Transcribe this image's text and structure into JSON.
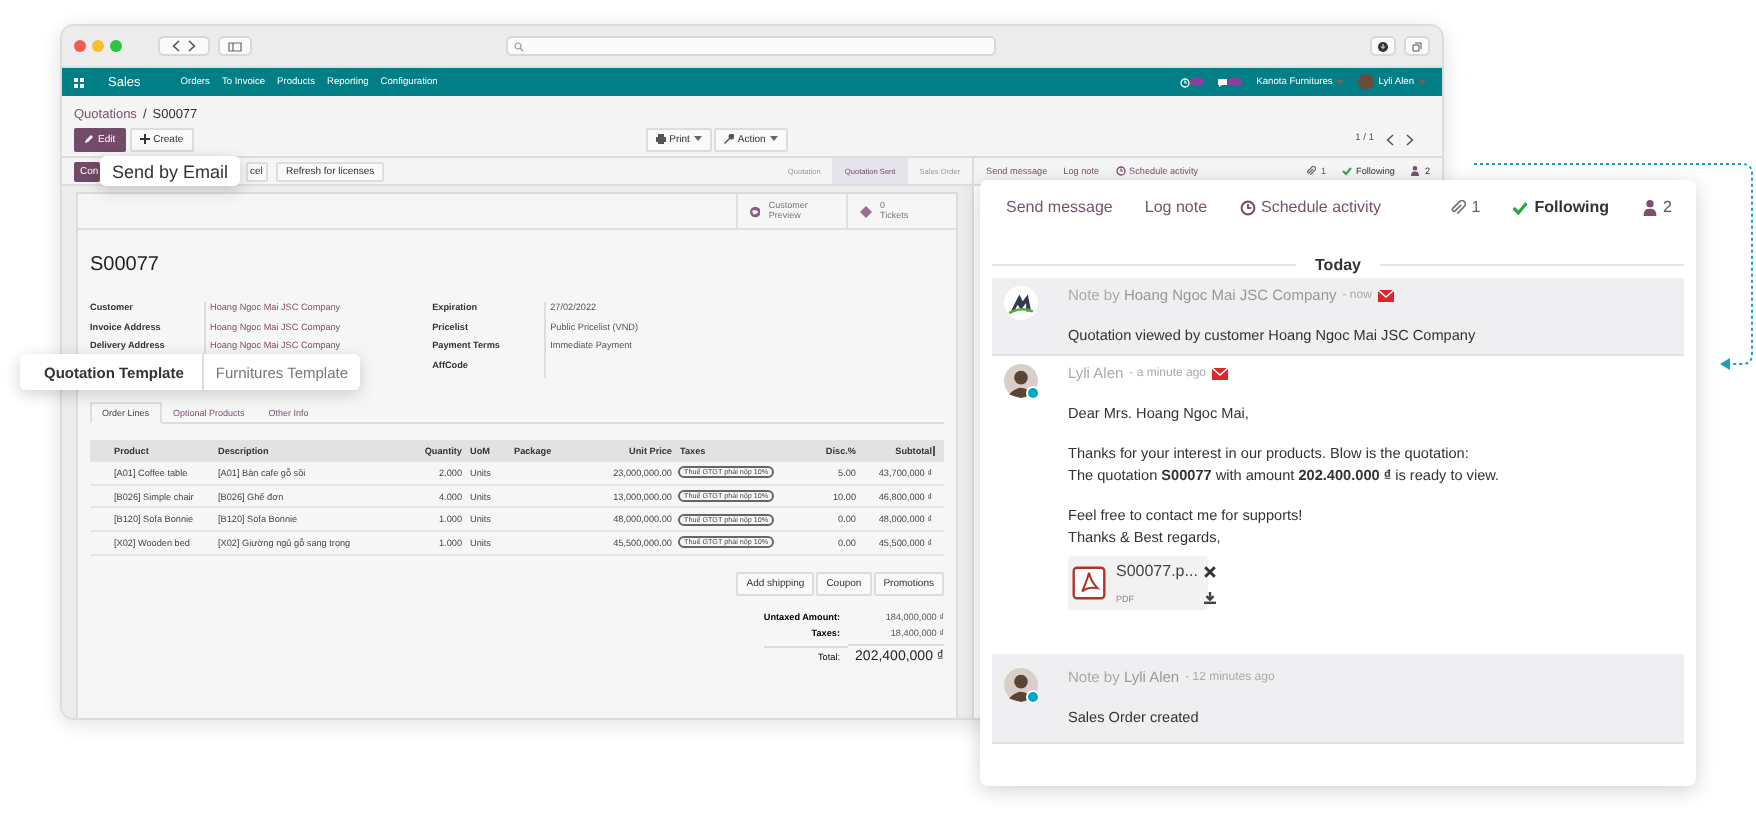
{
  "navbar": {
    "app": "Sales",
    "menu": [
      "Orders",
      "To Invoice",
      "Products",
      "Reporting",
      "Configuration"
    ],
    "company": "Kanota Furnitures",
    "user": "Lyli Alen"
  },
  "breadcrumb": {
    "parent": "Quotations",
    "separator": "/",
    "current": "S00077"
  },
  "actions": [
    {
      "label": "Edit",
      "kind": "primary"
    },
    {
      "label": "Create",
      "kind": "secondary"
    }
  ],
  "dropdowns": [
    "Print",
    "Action"
  ],
  "pager": "1 / 1",
  "header_buttons": [
    {
      "label": "Con",
      "kind": "primary"
    },
    {
      "label": "cel",
      "kind": "secondary"
    },
    {
      "label": "Refresh for licenses",
      "kind": "secondary"
    }
  ],
  "status_steps": [
    {
      "label": "Quotation",
      "selected": false
    },
    {
      "label": "Quotation Sent",
      "selected": true
    },
    {
      "label": "Sales Order",
      "selected": false
    }
  ],
  "smart_buttons": [
    {
      "kind": "preview",
      "label": "Customer Preview"
    },
    {
      "kind": "tickets",
      "count": "0",
      "label": "Tickets"
    }
  ],
  "title": "S00077",
  "fields_left": [
    {
      "label": "Customer",
      "value": "Hoang Ngoc Mai JSC Company"
    },
    {
      "label": "Invoice Address",
      "value": "Hoang Ngoc Mai JSC Company"
    },
    {
      "label": "Delivery Address",
      "value": "Hoang Ngoc Mai JSC Company"
    }
  ],
  "fields_right": [
    {
      "label": "Expiration",
      "value": "27/02/2022"
    },
    {
      "label": "Pricelist",
      "value": "Public Pricelist (VND)"
    },
    {
      "label": "Payment Terms",
      "value": "Immediate Payment"
    },
    {
      "label": "AffCode"
    }
  ],
  "notebook_tabs": [
    {
      "label": "Order Lines",
      "selected": true
    },
    {
      "label": "Optional Products",
      "selected": false
    },
    {
      "label": "Other Info",
      "selected": false
    }
  ],
  "order_lines": {
    "columns": [
      "Product",
      "Description",
      "Quantity",
      "UoM",
      "Package",
      "Unit Price",
      "Taxes",
      "Disc.%",
      "Subtotal"
    ],
    "rows": [
      {
        "product": "[A01] Coffee table",
        "description": "[A01] Bàn cafe gỗ sồi",
        "quantity": "2.000",
        "uom": "Units",
        "unit_price": "23,000,000.00",
        "tax": "Thuế GTGT phải nộp 10%",
        "discount": "5.00",
        "subtotal": "43,700,000 ₫"
      },
      {
        "product": "[B026] Simple chair",
        "description": "[B026] Ghế đơn",
        "quantity": "4.000",
        "uom": "Units",
        "unit_price": "13,000,000.00",
        "tax": "Thuế GTGT phải nộp 10%",
        "discount": "10.00",
        "subtotal": "46,800,000 ₫"
      },
      {
        "product": "[B120] Sofa Bonnie",
        "description": "[B120] Sofa Bonnie",
        "quantity": "1.000",
        "uom": "Units",
        "unit_price": "48,000,000.00",
        "tax": "Thuế GTGT phải nộp 10%",
        "discount": "0.00",
        "subtotal": "48,000,000 ₫"
      },
      {
        "product": "[X02] Wooden bed",
        "description": "[X02] Giường ngủ gỗ sang trọng",
        "quantity": "1.000",
        "uom": "Units",
        "unit_price": "45,500,000.00",
        "tax": "Thuế GTGT phải nộp 10%",
        "discount": "0.00",
        "subtotal": "45,500,000 ₫"
      }
    ]
  },
  "line_buttons": [
    "Add shipping",
    "Coupon",
    "Promotions"
  ],
  "totals": [
    {
      "label": "Untaxed Amount:",
      "value": "184,000,000 ₫",
      "kind": "line"
    },
    {
      "label": "Taxes:",
      "value": "18,400,000 ₫",
      "kind": "line"
    },
    {
      "label": "Total:",
      "value": "202,400,000 ₫",
      "kind": "grand"
    }
  ],
  "window_chatter": {
    "send": "Send message",
    "log": "Log note",
    "schedule": "Schedule activity",
    "attachments": "1",
    "follow": "Following",
    "followers": "2"
  },
  "callouts": {
    "send_email": "Send by Email",
    "template_label": "Quotation Template",
    "template_value": "Furnitures Template"
  },
  "chatter": {
    "send": "Send message",
    "log": "Log note",
    "schedule": "Schedule activity",
    "attachments": "1",
    "follow": "Following",
    "followers": "2",
    "date": "Today",
    "messages": [
      {
        "kind": "note",
        "avatar": {
          "kind": "company"
        },
        "online": false,
        "header": "Note by **Hoang Ngoc Mai JSC Company**",
        "time": "- now",
        "via_email": true,
        "paragraphs": [
          [
            "Quotation viewed by customer Hoang Ngoc Mai JSC Company"
          ]
        ]
      },
      {
        "kind": "message",
        "avatar": {
          "kind": "person"
        },
        "online": true,
        "header": "Lyli Alen",
        "time": "- a minute ago",
        "via_email": true,
        "paragraphs": [
          [
            "Dear Mrs. Hoang Ngoc Mai,"
          ],
          [
            "Thanks for your interest in our products. Blow is the quotation:",
            "The quotation **S00077** with amount **202.400.000 ₫** is ready to view."
          ],
          [
            "Feel free to contact me for supports!",
            "Thanks & Best regards,"
          ]
        ],
        "attachment": {
          "name": "S00077.p...",
          "type": "PDF"
        }
      },
      {
        "kind": "note",
        "avatar": {
          "kind": "person"
        },
        "online": true,
        "header": "Note by **Lyli Alen**",
        "time": "- 12 minutes ago",
        "via_email": false,
        "paragraphs": [
          [
            "Sales Order created"
          ]
        ]
      }
    ]
  }
}
